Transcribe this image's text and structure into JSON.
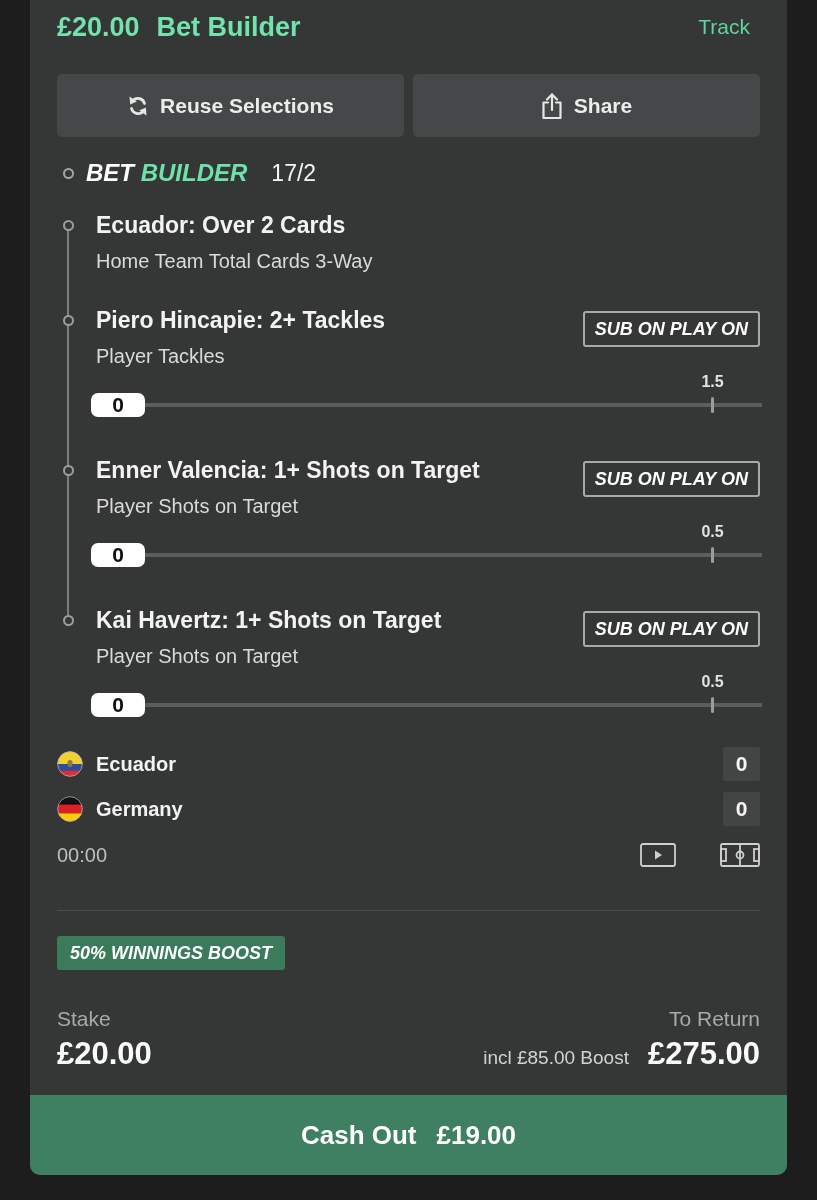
{
  "header": {
    "stake": "£20.00",
    "bet_type": "Bet Builder",
    "track_link": "Track"
  },
  "actions": [
    {
      "kind": "reuse",
      "label": "Reuse Selections"
    },
    {
      "kind": "share",
      "label": "Share"
    }
  ],
  "bet_builder": {
    "wordmark_prefix": "BET",
    "wordmark_highlight": "BUILDER",
    "odds": "17/2"
  },
  "legs": [
    {
      "title": "Ecuador: Over 2 Cards",
      "market": "Home Team Total Cards 3-Way"
    },
    {
      "title": "Piero Hincapie: 2+ Tackles",
      "market": "Player Tackles",
      "promo": "SUB ON PLAY ON",
      "progress": {
        "current": "0",
        "target": "1.5",
        "level": 0
      }
    },
    {
      "title": "Enner Valencia: 1+ Shots on Target",
      "market": "Player Shots on Target",
      "promo": "SUB ON PLAY ON",
      "progress": {
        "current": "0",
        "target": "0.5",
        "level": 0
      }
    },
    {
      "title": "Kai Havertz: 1+ Shots on Target",
      "market": "Player Shots on Target",
      "promo": "SUB ON PLAY ON",
      "progress": {
        "current": "0",
        "target": "0.5",
        "level": 0
      }
    }
  ],
  "match": {
    "teams": [
      {
        "name": "Ecuador",
        "score": "0"
      },
      {
        "name": "Germany",
        "score": "0"
      }
    ],
    "clock": "00:00"
  },
  "boost_tag": "50% WINNINGS BOOST",
  "stake": {
    "label": "Stake",
    "value": "£20.00"
  },
  "returns": {
    "label": "To Return",
    "boost_note": "incl £85.00 Boost",
    "value": "£275.00"
  },
  "cash_out": {
    "label": "Cash Out",
    "value": "£19.00"
  }
}
